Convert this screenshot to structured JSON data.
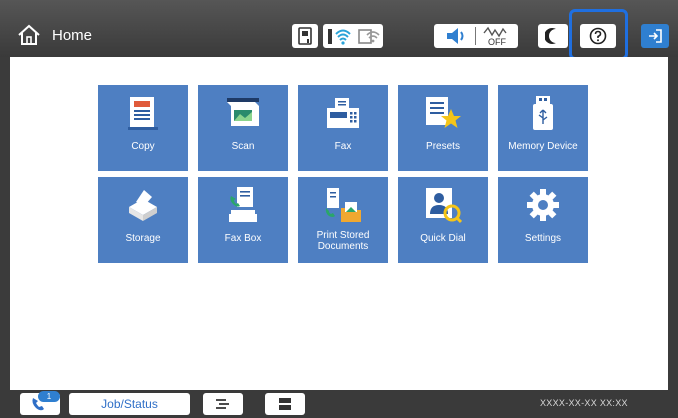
{
  "header": {
    "home_label": "Home",
    "status_icons": [
      "memory-device-icon",
      "wifi-icon",
      "wifi-direct-icon",
      "volume-icon",
      "power-save-off-icon",
      "sleep-icon"
    ],
    "help_icon": "help-icon",
    "logout_icon": "logout-icon"
  },
  "menu": {
    "tiles": [
      {
        "label": "Copy",
        "icon": "copy-icon"
      },
      {
        "label": "Scan",
        "icon": "scan-icon"
      },
      {
        "label": "Fax",
        "icon": "fax-icon"
      },
      {
        "label": "Presets",
        "icon": "presets-icon"
      },
      {
        "label": "Memory Device",
        "icon": "memory-device-icon"
      },
      {
        "label": "Storage",
        "icon": "storage-icon"
      },
      {
        "label": "Fax Box",
        "icon": "fax-box-icon"
      },
      {
        "label": "Print Stored Documents",
        "icon": "print-stored-documents-icon"
      },
      {
        "label": "Quick Dial",
        "icon": "quick-dial-icon"
      },
      {
        "label": "Settings",
        "icon": "settings-icon"
      }
    ]
  },
  "footer": {
    "job_status_label": "Job/Status",
    "datetime": "XXXX-XX-XX XX:XX",
    "badge_count": "1"
  },
  "colors": {
    "accent_blue": "#4e7fc2",
    "highlight_blue": "#1f6fe0",
    "topbar": "#444444"
  }
}
